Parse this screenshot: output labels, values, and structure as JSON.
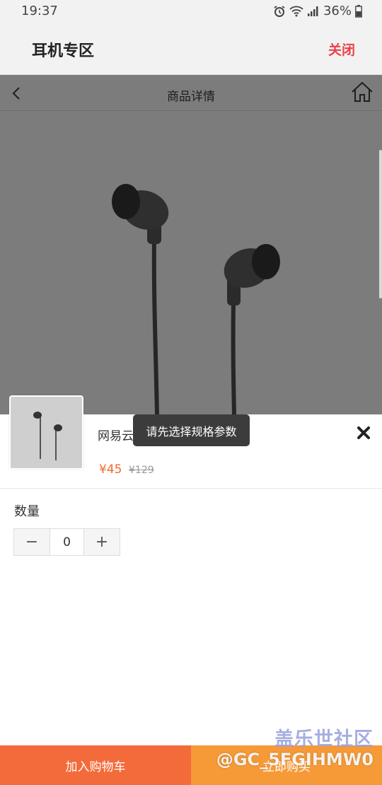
{
  "status_bar": {
    "time": "19:37",
    "battery": "36%",
    "icons": [
      "alarm-icon",
      "wifi-icon",
      "signal-icon",
      "battery-icon"
    ]
  },
  "title_bar": {
    "title": "耳机专区",
    "close_label": "关闭"
  },
  "product_nav": {
    "title": "商品详情",
    "icons": [
      "back-arrow-icon",
      "home-icon"
    ]
  },
  "sheet": {
    "product_name": "网易云音乐 耳机 标准版",
    "price_now": "¥45",
    "price_old": "¥129",
    "quantity_label": "数量",
    "quantity_value": "0",
    "minus": "−",
    "plus": "+"
  },
  "toast": {
    "message": "请先选择规格参数"
  },
  "bottom_bar": {
    "add_to_cart": "加入购物车",
    "buy_now": "立即购买"
  },
  "watermark": {
    "brand": "盖乐世社区",
    "user": "@GC_5FGIHMW0"
  },
  "colors": {
    "accent_red": "#e8424a",
    "price_orange": "#f26b2a",
    "cart_button": "#f36b3a",
    "buy_button": "#f69a37"
  }
}
